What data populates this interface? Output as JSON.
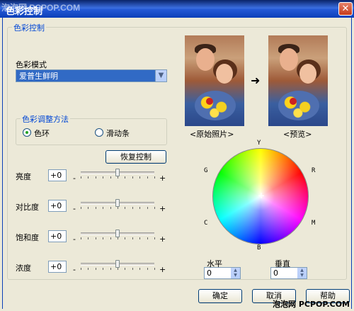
{
  "window": {
    "title": "色彩控制",
    "close_glyph": "✕"
  },
  "watermarks": {
    "top": "泡泡网 PCPOP.COM",
    "bottom": "泡泡网 PCPOP.COM"
  },
  "color_control_group": {
    "label": "色彩控制",
    "color_mode_label": "色彩模式",
    "color_mode_selected": "爱普生鲜明",
    "adjust_method_group": {
      "label": "色彩调整方法",
      "options": [
        {
          "label": "色环",
          "checked": true
        },
        {
          "label": "滑动条",
          "checked": false
        }
      ]
    },
    "restore_button": "恢复控制",
    "sliders": [
      {
        "label": "亮度",
        "value": "+0",
        "minus": "-",
        "plus": "+",
        "level": 0.5
      },
      {
        "label": "对比度",
        "value": "+0",
        "minus": "-",
        "plus": "+",
        "level": 0.5
      },
      {
        "label": "饱和度",
        "value": "+0",
        "minus": "-",
        "plus": "+",
        "level": 0.5
      },
      {
        "label": "浓度",
        "value": "+0",
        "minus": "-",
        "plus": "+",
        "level": 0.5
      }
    ],
    "preview": {
      "original_label": "<原始照片>",
      "preview_label": "<预览>",
      "arrow": "➜"
    },
    "color_wheel": {
      "letters": {
        "Y": "Y",
        "R": "R",
        "M": "M",
        "B": "B",
        "C": "C",
        "G": "G"
      },
      "center_mark": "+",
      "horizontal_label": "水平",
      "horizontal_value": "0",
      "vertical_label": "垂直",
      "vertical_value": "0"
    }
  },
  "footer_buttons": {
    "ok": "确定",
    "cancel": "取消",
    "help": "帮助"
  },
  "colors": {
    "title_bar": "#2257d5",
    "group_label": "#0046d5",
    "selection": "#316ac5",
    "dialog_bg": "#ece9d8"
  },
  "icons": {
    "dropdown": "chevron-down-icon",
    "spin": "spin-arrows-icon",
    "arrow": "right-arrow-icon"
  }
}
